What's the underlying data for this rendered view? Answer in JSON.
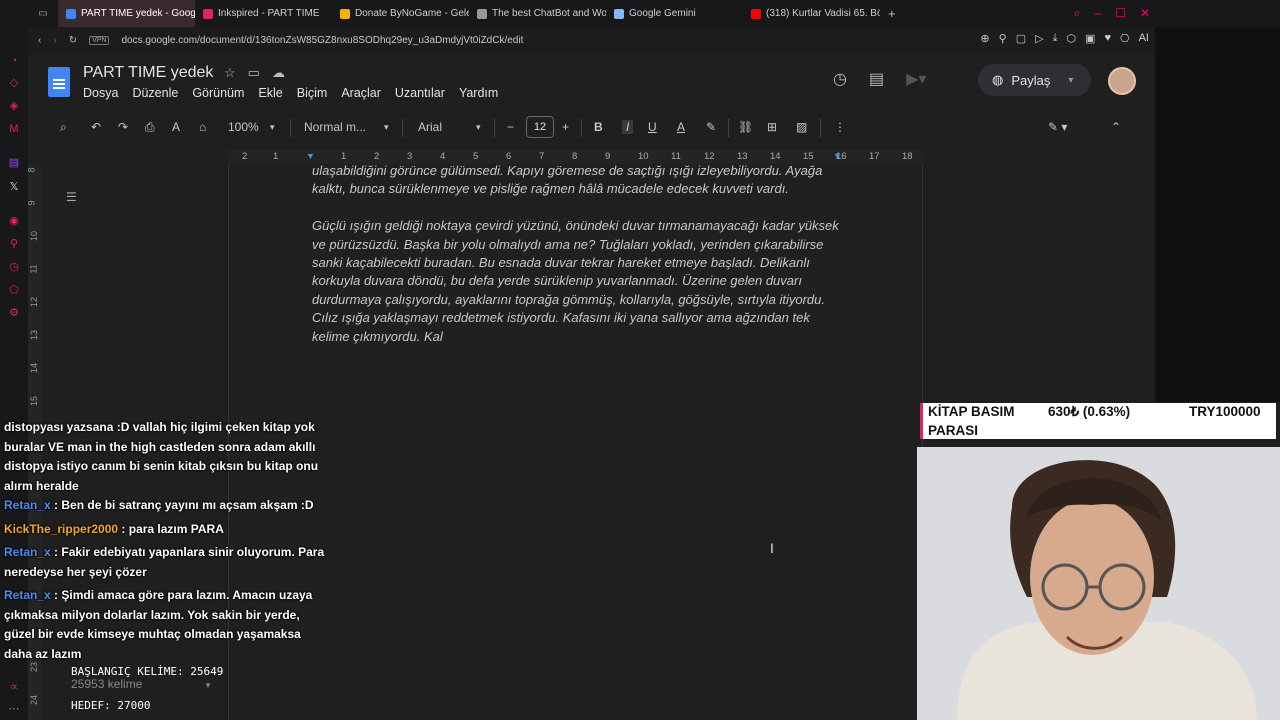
{
  "browser": {
    "tabs": [
      {
        "label": "PART TIME yedek - Google",
        "active": true,
        "color": "#4285f4"
      },
      {
        "label": "Inkspired - PART TIME",
        "active": false,
        "color": "#e0245e"
      },
      {
        "label": "Donate ByNoGame - Gele",
        "active": false,
        "color": "#f5b400"
      },
      {
        "label": "The best ChatBot and Wo",
        "active": false,
        "color": "#999999"
      },
      {
        "label": "Google Gemini",
        "active": false,
        "color": "#8ab4f8"
      },
      {
        "label": "(318) Kurtlar Vadisi 65. Bö",
        "active": false,
        "color": "#ff0000"
      }
    ],
    "vpn": "VPN",
    "url": "docs.google.com/document/d/136tonZsW85GZ8nxu8SODhq29ey_u3aDmdyjVt0iZdCk/edit",
    "ai_label": "AI"
  },
  "docs": {
    "title": "PART TIME yedek",
    "menu": [
      "Dosya",
      "Düzenle",
      "Görünüm",
      "Ekle",
      "Biçim",
      "Araçlar",
      "Uzantılar",
      "Yardım"
    ],
    "share_label": "Paylaş",
    "toolbar": {
      "zoom": "100%",
      "style": "Normal m...",
      "font": "Arial",
      "font_size": "12"
    },
    "ruler_numbers": [
      "2",
      "1",
      "1",
      "2",
      "3",
      "4",
      "5",
      "6",
      "7",
      "8",
      "9",
      "10",
      "11",
      "12",
      "13",
      "14",
      "15",
      "16",
      "17",
      "18"
    ],
    "vruler_numbers": [
      "8",
      "9",
      "10",
      "11",
      "12",
      "13",
      "14",
      "15",
      "23",
      "24"
    ],
    "paragraphs": [
      "ulaşabildiğini görünce gülümsedi. Kapıyı göremese de saçtığı ışığı izleyebiliyordu. Ayağa kalktı, bunca sürüklenmeye ve pisliğe rağmen hâlâ mücadele edecek kuvveti vardı.",
      "Güçlü ışığın geldiği noktaya çevirdi yüzünü, önündeki duvar tırmanamayacağı kadar yüksek ve pürüzsüzdü. Başka bir yolu olmalıydı ama ne? Tuğlaları yokladı, yerinden çıkarabilirse sanki kaçabilecekti buradan. Bu esnada duvar tekrar hareket etmeye başladı. Delikanlı korkuyla duvara döndü, bu defa yerde sürüklenip yuvarlanmadı. Üzerine gelen duvarı durdurmaya çalışıyordu, ayaklarını toprağa gömmüş, kollarıyla, göğsüyle, sırtıyla itiyordu. Cılız ışığa yaklaşmayı reddetmek istiyordu. Kafasını iki yana sallıyor ama ağzından tek kelime çıkmıyordu. Kal"
    ],
    "word_count": "25953 kelime"
  },
  "donation": {
    "label": "KİTAP BASIM",
    "amount": "630₺ (0.63%)",
    "goal": "TRY100000",
    "label2": "PARASI",
    "progress_fraction": 0.0063
  },
  "chat": [
    {
      "user": "",
      "text": "distopyası yazsana :D vallah hiç ilgimi çeken kitap yok buralar VE man in the high castleden sonra adam akıllı distopya istiyo canım bi senin kitab çıksın bu kitap onu alırm heralde"
    },
    {
      "user": "Retan_x",
      "text": ": Ben de bi satranç yayını mı açsam akşam :D"
    },
    {
      "user": "KickThe_ripper2000",
      "text": ": para lazım PARA",
      "orange": true
    },
    {
      "user": "Retan_x",
      "text": ": Fakir edebiyatı yapanlara sinir oluyorum. Para neredeyse her şeyi çözer"
    },
    {
      "user": "Retan_x",
      "text": ": Şimdi amaca göre para lazım. Amacın uzaya çıkmaksa milyon dolarlar lazım. Yok sakin bir yerde, güzel bir evde kimseye muhtaç olmadan yaşamaksa daha az lazım"
    }
  ],
  "stats": {
    "start_words": "BAŞLANGIÇ KELİME: 25649",
    "target": "HEDEF: 27000"
  }
}
